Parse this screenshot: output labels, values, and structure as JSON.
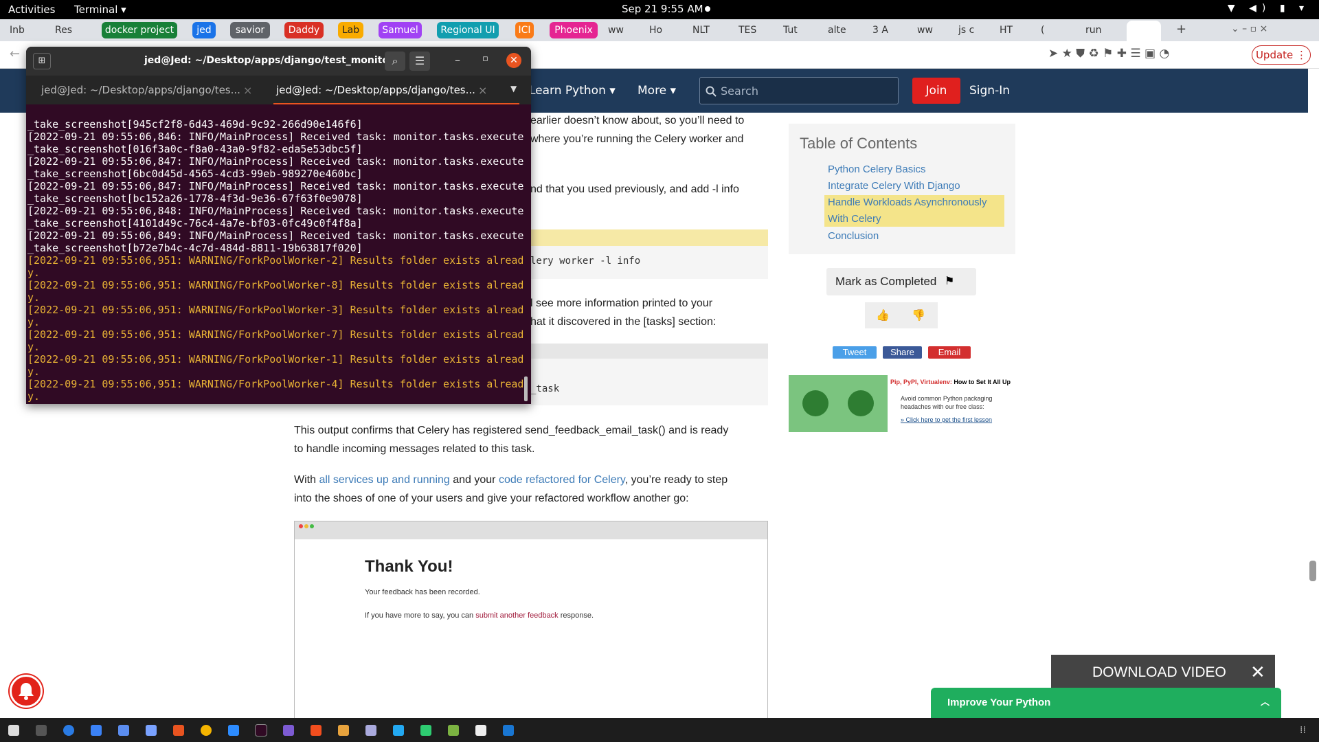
{
  "topbar": {
    "activities": "Activities",
    "app": "Terminal ▾",
    "clock": "Sep 21  9:55 AM",
    "sys": "▼ ◀) ▮ ▾"
  },
  "tabs": [
    "Inb",
    "Res",
    "ww",
    "Ho",
    "NLT",
    "TES",
    "Tut",
    "alte",
    "3 A",
    "ww",
    "js c",
    "HT",
    "(",
    "run"
  ],
  "groups": [
    {
      "label": "docker project",
      "color": "#188038"
    },
    {
      "label": "jed",
      "color": "#1a73e8"
    },
    {
      "label": "savior",
      "color": "#5f6368"
    },
    {
      "label": "Daddy",
      "color": "#d93025"
    },
    {
      "label": "Lab",
      "color": "#f9ab00"
    },
    {
      "label": "Samuel",
      "color": "#a142f4"
    },
    {
      "label": "Regional UI",
      "color": "#129eaf"
    },
    {
      "label": "ICI",
      "color": "#fa7b17"
    },
    {
      "label": "Phoenix",
      "color": "#e52592"
    }
  ],
  "browser": {
    "update": "Update ⋮"
  },
  "site": {
    "learn": "Learn Python ▾",
    "more": "More ▾",
    "search_placeholder": "Search",
    "join": "Join",
    "signin": "Sign-In"
  },
  "article": {
    "p1a": "earlier doesn’t know about, so you’ll need to",
    "p1b": "where you’re running the Celery worker and",
    "p2": "nd that you used previously, and add -l info",
    "code1": "lery worker -l info",
    "p3a": "l see more information printed to your",
    "p3b": "hat it discovered in the [tasks] section:",
    "code2": "_task",
    "p4a": "This output confirms that Celery has registered send_feedback_email_task() and is ready",
    "p4b": "to handle incoming messages related to this task.",
    "p5a_pre": "With ",
    "p5a_link1": "all services up and running",
    "p5a_mid": " and your ",
    "p5a_link2": "code refactored for Celery",
    "p5a_post": ", you’re ready to step",
    "p5b": "into the shoes of one of your users and give your refactored workflow another go:",
    "shot_title": "Thank You!",
    "shot_l1": "Your feedback has been recorded.",
    "shot_l2_pre": "If you have more to say, you can ",
    "shot_l2_link": "submit another feedback",
    "shot_l2_post": " response."
  },
  "toc": {
    "title": "Table of Contents",
    "items": [
      "Python Celery Basics",
      "Integrate Celery With Django",
      "Handle Workloads Asynchronously",
      "With Celery",
      "Conclusion"
    ]
  },
  "actions": {
    "mark": "Mark as Completed",
    "tweet": "Tweet",
    "share": "Share",
    "email": "Email"
  },
  "ad": {
    "head_red": "Pip, PyPI, Virtualenv:",
    "head_rest": " How to Set It All Up",
    "l1": "Avoid common Python packaging",
    "l2": "headaches with our free class:",
    "link": "» Click here to get the first lesson"
  },
  "terminal": {
    "title": "jed@Jed: ~/Desktop/apps/django/test_monitor",
    "tab1": "jed@Jed: ~/Desktop/apps/django/tes...",
    "tab2": "jed@Jed: ~/Desktop/apps/django/tes...",
    "lines": [
      "_take_screenshot[945cf2f8-6d43-469d-9c92-266d90e146f6]",
      "[2022-09-21 09:55:06,846: INFO/MainProcess] Received task: monitor.tasks.execute",
      "_take_screenshot[016f3a0c-f8a0-43a0-9f82-eda5e53dbc5f]",
      "[2022-09-21 09:55:06,847: INFO/MainProcess] Received task: monitor.tasks.execute",
      "_take_screenshot[6bc0d45d-4565-4cd3-99eb-989270e460bc]",
      "[2022-09-21 09:55:06,847: INFO/MainProcess] Received task: monitor.tasks.execute",
      "_take_screenshot[bc152a26-1778-4f3d-9e36-67f63f0e9078]",
      "[2022-09-21 09:55:06,848: INFO/MainProcess] Received task: monitor.tasks.execute",
      "_take_screenshot[4101d49c-76c4-4a7e-bf03-0fc49c0f4f8a]",
      "[2022-09-21 09:55:06,849: INFO/MainProcess] Received task: monitor.tasks.execute",
      "_take_screenshot[b72e7b4c-4c7d-484d-8811-19b63817f020]"
    ],
    "warnings": [
      "[2022-09-21 09:55:06,951: WARNING/ForkPoolWorker-2] Results folder exists alread",
      "[2022-09-21 09:55:06,951: WARNING/ForkPoolWorker-8] Results folder exists alread",
      "[2022-09-21 09:55:06,951: WARNING/ForkPoolWorker-3] Results folder exists alread",
      "[2022-09-21 09:55:06,951: WARNING/ForkPoolWorker-7] Results folder exists alread",
      "[2022-09-21 09:55:06,951: WARNING/ForkPoolWorker-1] Results folder exists alread",
      "[2022-09-21 09:55:06,951: WARNING/ForkPoolWorker-4] Results folder exists alread"
    ],
    "wrap": "y."
  },
  "overlays": {
    "download": "DOWNLOAD VIDEO",
    "improve": "Improve Your Python"
  }
}
